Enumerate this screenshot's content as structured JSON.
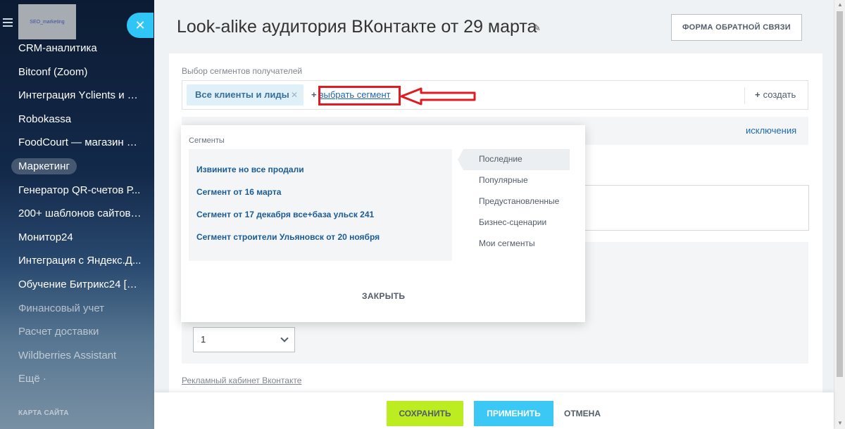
{
  "sidebar": {
    "logo_text": "SEO_marketing",
    "items": [
      {
        "label": "CRM-аналитика"
      },
      {
        "label": "Bitconf (Zoom)"
      },
      {
        "label": "Интеграция Yclients и Б..."
      },
      {
        "label": "Robokassa"
      },
      {
        "label": "FoodCourt — магазин д..."
      },
      {
        "label": "Маркетинг"
      },
      {
        "label": "Генератор QR-счетов Р..."
      },
      {
        "label": "200+ шаблонов сайтов ..."
      },
      {
        "label": "Монитор24"
      },
      {
        "label": "Интеграция с Яндекс.Д..."
      },
      {
        "label": "Обучение Битрикс24 [E..."
      },
      {
        "label": "Финансовый учет"
      },
      {
        "label": "Расчет доставки"
      },
      {
        "label": "Wildberries Assistant"
      },
      {
        "label": "Ещё ·"
      }
    ],
    "sitemap": "КАРТА САЙТА"
  },
  "header": {
    "title": "Look-alike аудитория ВКонтакте от 29 марта",
    "feedback_button": "ФОРМА ОБРАТНОЙ СВЯЗИ"
  },
  "segments": {
    "label": "Выбор сегментов получателей",
    "chip": "Все клиенты и лиды",
    "choose": "выбрать сегмент",
    "create": "создать",
    "exclusions": "исключения"
  },
  "popup": {
    "label": "Сегменты",
    "items": [
      "Извините но все продали",
      "Сегмент от 16 марта",
      "Сегмент от 17 декабря все+база ульск 241",
      "Сегмент строители Ульяновск от 20 ноября"
    ],
    "tabs": [
      "Последние",
      "Популярные",
      "Предустановленные",
      "Бизнес-сценарии",
      "Мои сегменты"
    ],
    "close": "ЗАКРЫТЬ"
  },
  "form": {
    "select_value": "1",
    "vk_link": "Рекламный кабинет Вконтакте"
  },
  "footer": {
    "save": "СОХРАНИТЬ",
    "apply": "ПРИМЕНИТЬ",
    "cancel": "ОТМЕНА"
  },
  "colors": {
    "accent_blue": "#2fc6f6",
    "save_green": "#bbed21",
    "highlight_red": "#e01a22",
    "link_blue": "#2067b0"
  }
}
